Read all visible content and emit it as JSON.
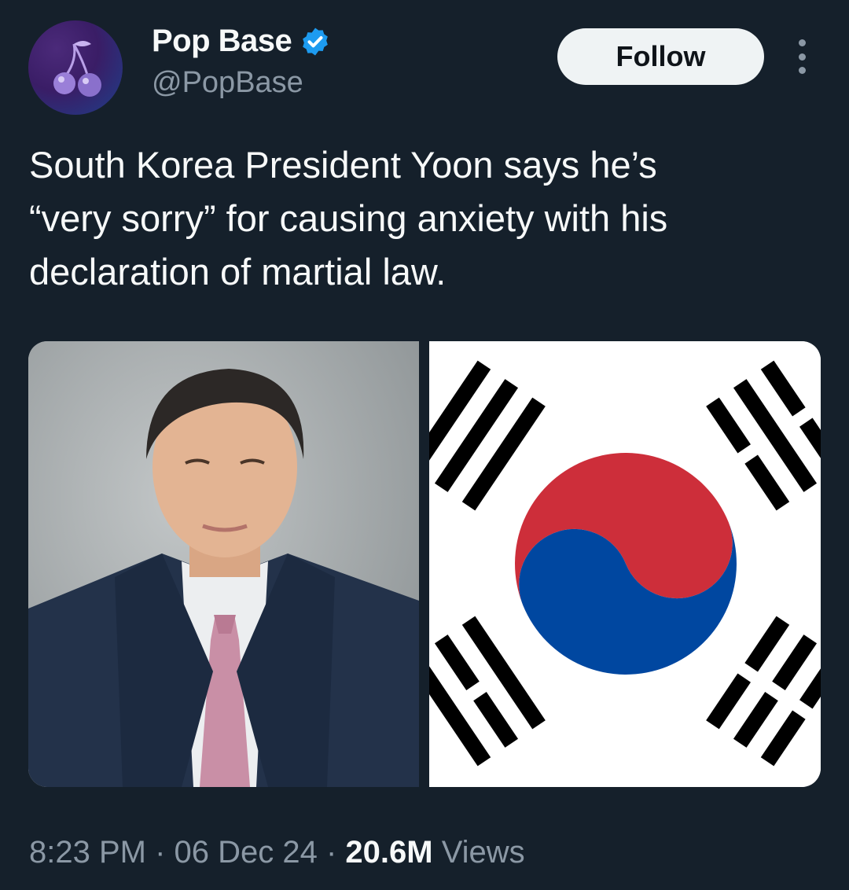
{
  "author": {
    "name": "Pop Base",
    "handle": "@PopBase",
    "verified": true,
    "avatar_icon": "cherry-icon"
  },
  "actions": {
    "follow_label": "Follow",
    "more_icon": "more-vertical-icon"
  },
  "tweet": {
    "text": "South Korea President Yoon says he’s\n“very sorry” for causing anxiety with his\ndeclaration of martial law.",
    "media": [
      "portrait-photo",
      "south-korea-flag"
    ]
  },
  "meta": {
    "time": "8:23 PM",
    "sep1": " · ",
    "date": "06 Dec 24",
    "sep2": " · ",
    "views_count": "20.6M",
    "views_label": " Views"
  },
  "colors": {
    "background": "#15202b",
    "verified": "#1d9bf0",
    "flag_red": "#cd2e3a",
    "flag_blue": "#0047a0"
  }
}
